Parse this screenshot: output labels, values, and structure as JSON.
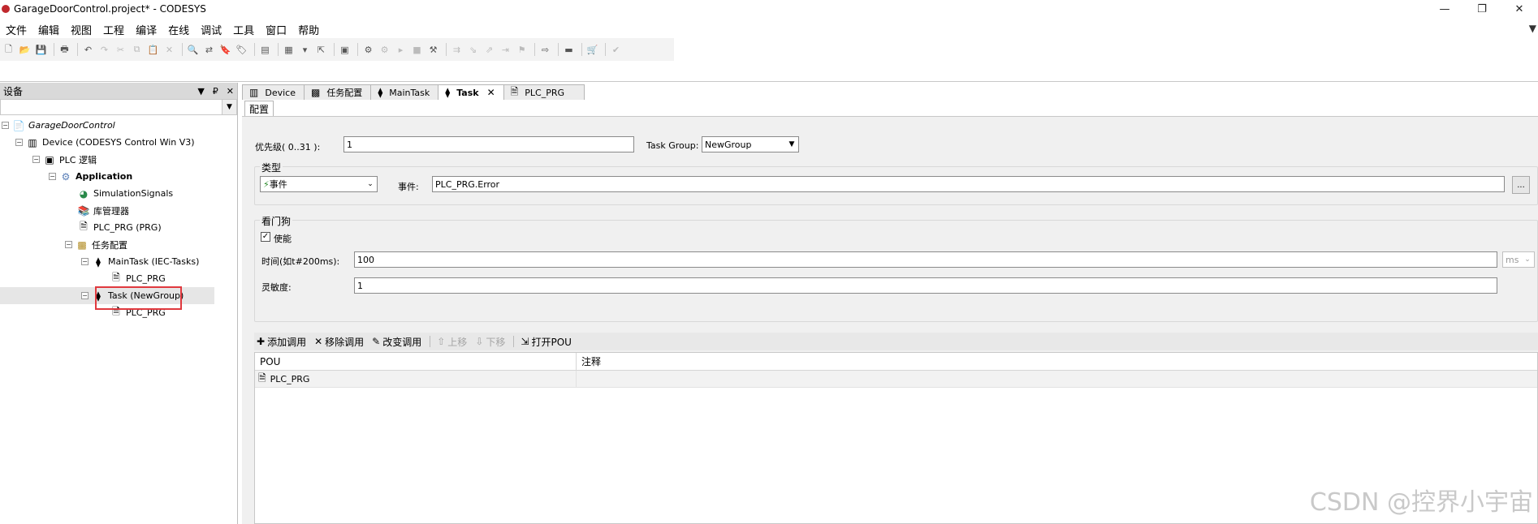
{
  "window": {
    "title": "GarageDoorControl.project* - CODESYS",
    "controls": [
      "—",
      "❐",
      "✕"
    ]
  },
  "menu": [
    "文件",
    "编辑",
    "视图",
    "工程",
    "编译",
    "在线",
    "调试",
    "工具",
    "窗口",
    "帮助"
  ],
  "device_panel": {
    "title": "设备",
    "tree": [
      {
        "label": "GarageDoorControl",
        "icon": "project-icon",
        "style": "italic"
      },
      {
        "label": "Device (CODESYS Control Win V3)",
        "icon": "device-icon"
      },
      {
        "label": "PLC 逻辑",
        "icon": "plc-logic-icon"
      },
      {
        "label": "Application",
        "icon": "application-gear-icon",
        "style": "bold"
      },
      {
        "label": "SimulationSignals",
        "icon": "simulation-icon"
      },
      {
        "label": "库管理器",
        "icon": "library-icon"
      },
      {
        "label": "PLC_PRG (PRG)",
        "icon": "pou-icon"
      },
      {
        "label": "任务配置",
        "icon": "task-config-icon"
      },
      {
        "label": "MainTask (IEC-Tasks)",
        "icon": "task-icon"
      },
      {
        "label": "PLC_PRG",
        "icon": "pou-call-icon"
      },
      {
        "label": "Task (NewGroup)",
        "icon": "task-icon"
      },
      {
        "label": "PLC_PRG",
        "icon": "pou-call-icon"
      }
    ]
  },
  "tabs": [
    {
      "label": "Device",
      "icon": "device-icon",
      "active": false
    },
    {
      "label": "任务配置",
      "icon": "task-config-icon",
      "active": false
    },
    {
      "label": "MainTask",
      "icon": "task-icon",
      "active": false
    },
    {
      "label": "Task",
      "icon": "task-icon",
      "active": true,
      "close": "✕"
    },
    {
      "label": "PLC_PRG",
      "icon": "pou-icon",
      "active": false
    }
  ],
  "config": {
    "subtab": "配置",
    "priority_label": "优先级( 0..31 ):",
    "priority_value": "1",
    "task_group_label": "Task Group:",
    "task_group_value": "NewGroup",
    "type_group_title": "类型",
    "type_value": "事件",
    "event_label": "事件:",
    "event_value": "PLC_PRG.Error",
    "event_browse": "...",
    "watchdog_title": "看门狗",
    "enable_label": "使能",
    "enable_checked": true,
    "time_label": "时间(如t#200ms):",
    "time_value": "100",
    "time_unit": "ms",
    "sensitivity_label": "灵敏度:",
    "sensitivity_value": "1"
  },
  "call_toolbar": {
    "add": "添加调用",
    "remove": "移除调用",
    "change": "改变调用",
    "up": "上移",
    "down": "下移",
    "open": "打开POU"
  },
  "call_table": {
    "columns": [
      "POU",
      "注释"
    ],
    "rows": [
      {
        "pou": "PLC_PRG",
        "comment": ""
      }
    ]
  },
  "watermark": "CSDN @控界小宇宙"
}
